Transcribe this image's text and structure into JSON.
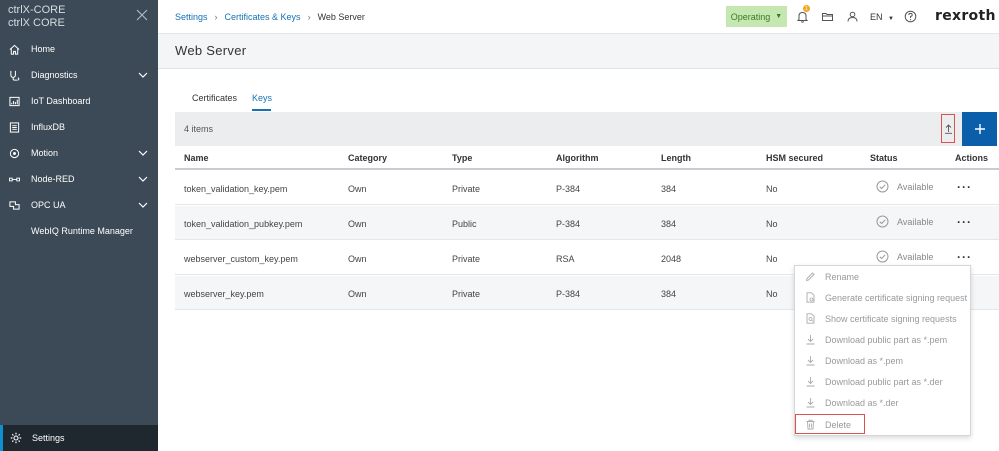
{
  "sidebar": {
    "brand_line1": "ctrlX-CORE",
    "brand_line2": "ctrlX CORE",
    "items": [
      {
        "label": "Home"
      },
      {
        "label": "Diagnostics"
      },
      {
        "label": "IoT Dashboard"
      },
      {
        "label": "InfluxDB"
      },
      {
        "label": "Motion"
      },
      {
        "label": "Node-RED"
      },
      {
        "label": "OPC UA"
      }
    ],
    "sub_item": "WebIQ Runtime Manager",
    "settings_label": "Settings"
  },
  "topbar": {
    "breadcrumb": [
      "Settings",
      "Certificates & Keys",
      "Web Server"
    ],
    "state_label": "Operating",
    "notification_count": "1",
    "language": "EN",
    "logo": "rexroth"
  },
  "page": {
    "title": "Web Server",
    "tabs": [
      "Certificates",
      "Keys"
    ],
    "active_tab": "Keys",
    "item_count": "4 items"
  },
  "table": {
    "columns": [
      "Name",
      "Category",
      "Type",
      "Algorithm",
      "Length",
      "HSM secured",
      "Status",
      "Actions"
    ],
    "rows": [
      {
        "name": "token_validation_key.pem",
        "category": "Own",
        "type": "Private",
        "algorithm": "P-384",
        "length": "384",
        "hsm": "No",
        "status": "Available"
      },
      {
        "name": "token_validation_pubkey.pem",
        "category": "Own",
        "type": "Public",
        "algorithm": "P-384",
        "length": "384",
        "hsm": "No",
        "status": "Available"
      },
      {
        "name": "webserver_custom_key.pem",
        "category": "Own",
        "type": "Private",
        "algorithm": "RSA",
        "length": "2048",
        "hsm": "No",
        "status": "Available"
      },
      {
        "name": "webserver_key.pem",
        "category": "Own",
        "type": "Private",
        "algorithm": "P-384",
        "length": "384",
        "hsm": "No",
        "status": ""
      }
    ]
  },
  "actions_menu": {
    "items": [
      {
        "label": "Rename",
        "icon": "pencil-icon"
      },
      {
        "label": "Generate certificate signing request",
        "icon": "document-gear-icon"
      },
      {
        "label": "Show certificate signing requests",
        "icon": "document-search-icon"
      },
      {
        "label": "Download public part as *.pem",
        "icon": "download-icon"
      },
      {
        "label": "Download as *.pem",
        "icon": "download-icon"
      },
      {
        "label": "Download public part as *.der",
        "icon": "download-icon"
      },
      {
        "label": "Download as *.der",
        "icon": "download-icon"
      },
      {
        "label": "Delete",
        "icon": "trash-icon"
      }
    ]
  },
  "colors": {
    "sidebar_bg": "#3b4a56",
    "accent": "#1672b4",
    "primary_button": "#0b5faa",
    "operating_bg": "#c5e8b3",
    "highlight_border": "#d9534f"
  }
}
